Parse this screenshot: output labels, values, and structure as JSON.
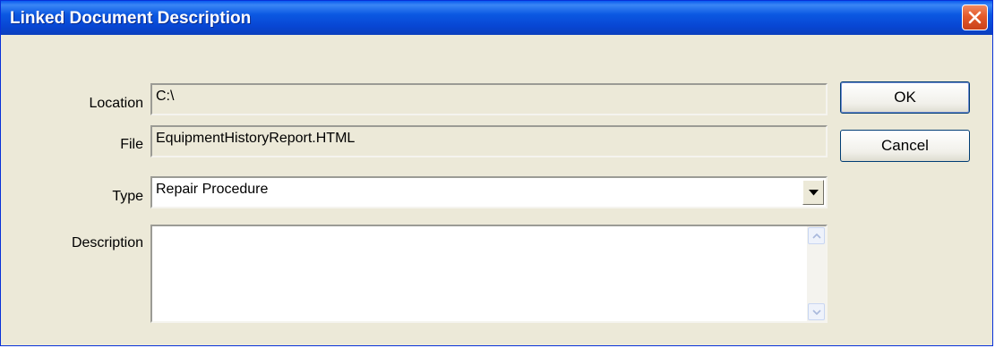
{
  "window": {
    "title": "Linked Document Description"
  },
  "form": {
    "location_label": "Location",
    "location_value": "C:\\",
    "file_label": "File",
    "file_value": "EquipmentHistoryReport.HTML",
    "type_label": "Type",
    "type_value": "Repair Procedure",
    "description_label": "Description",
    "description_value": ""
  },
  "buttons": {
    "ok_label": "OK",
    "cancel_label": "Cancel"
  },
  "icons": {
    "close": "close-icon",
    "dropdown": "chevron-down-icon",
    "scroll_up": "scroll-up-arrow-icon",
    "scroll_down": "scroll-down-arrow-icon"
  },
  "colors": {
    "titlebar": "#0a4fd6",
    "close_button": "#e35a2a",
    "dialog_background": "#ece9d8"
  }
}
